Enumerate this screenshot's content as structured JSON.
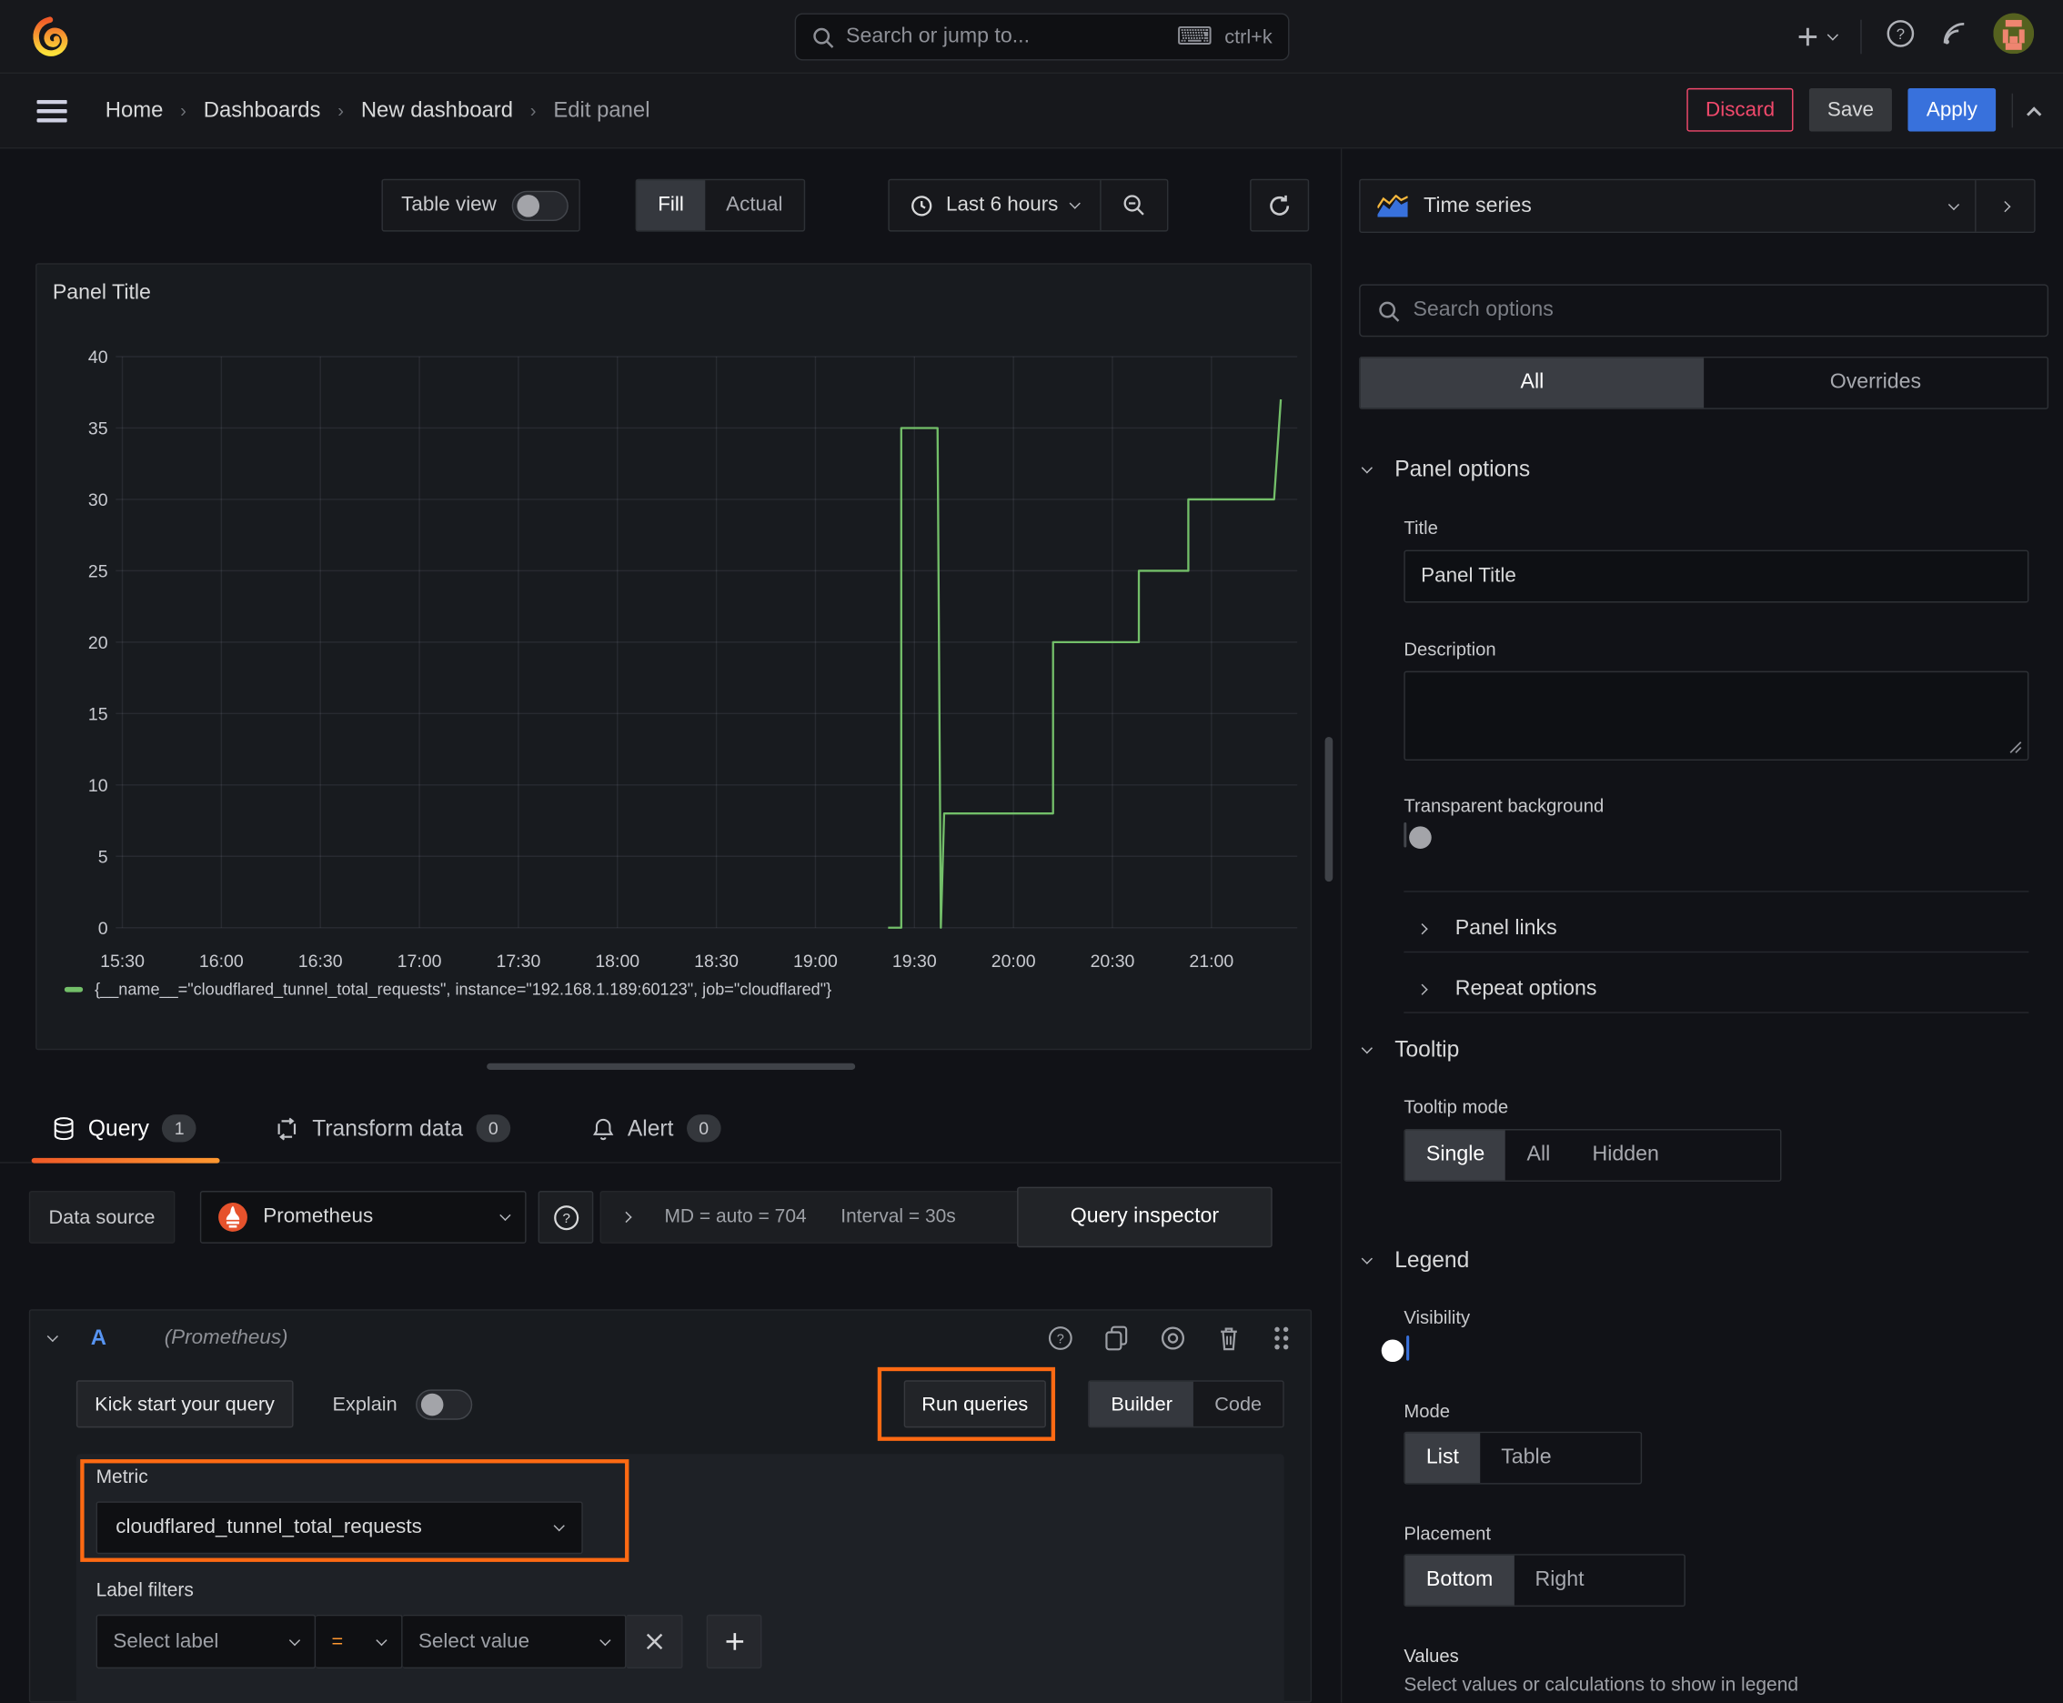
{
  "topnav": {
    "search_placeholder": "Search or jump to...",
    "search_shortcut": "ctrl+k"
  },
  "breadcrumb": {
    "items": [
      "Home",
      "Dashboards",
      "New dashboard",
      "Edit panel"
    ]
  },
  "actions": {
    "discard": "Discard",
    "save": "Save",
    "apply": "Apply"
  },
  "panel_toolbar": {
    "table_view": "Table view",
    "fill": "Fill",
    "actual": "Actual",
    "time_range": "Last 6 hours"
  },
  "panel": {
    "title": "Panel Title"
  },
  "chart_data": {
    "type": "line",
    "title": "Panel Title",
    "x_ticks": [
      "15:30",
      "16:00",
      "16:30",
      "17:00",
      "17:30",
      "18:00",
      "18:30",
      "19:00",
      "19:30",
      "20:00",
      "20:30",
      "21:00"
    ],
    "x_range": [
      "15:30",
      "21:26"
    ],
    "y_ticks": [
      0,
      5,
      10,
      15,
      20,
      25,
      30,
      35,
      40
    ],
    "ylim": [
      0,
      40
    ],
    "grid": true,
    "legend_position": "bottom",
    "series": [
      {
        "name": "{__name__=\"cloudflared_tunnel_total_requests\", instance=\"192.168.1.189:60123\", job=\"cloudflared\"}",
        "color": "#73bf69",
        "points": [
          [
            "19:22",
            0
          ],
          [
            "19:26",
            0
          ],
          [
            "19:26",
            35
          ],
          [
            "19:37",
            35
          ],
          [
            "19:38",
            0
          ],
          [
            "19:39",
            8
          ],
          [
            "20:12",
            8
          ],
          [
            "20:12",
            20
          ],
          [
            "20:38",
            20
          ],
          [
            "20:38",
            25
          ],
          [
            "20:53",
            25
          ],
          [
            "20:53",
            30
          ],
          [
            "21:19",
            30
          ],
          [
            "21:21",
            37
          ]
        ]
      }
    ]
  },
  "query_tabs": {
    "query": "Query",
    "query_count": "1",
    "transform": "Transform data",
    "transform_count": "0",
    "alert": "Alert",
    "alert_count": "0"
  },
  "datasource_row": {
    "label": "Data source",
    "value": "Prometheus",
    "stats": "MD = auto = 704",
    "interval": "Interval = 30s",
    "inspector": "Query inspector"
  },
  "query_editor": {
    "ref_id": "A",
    "ds_hint": "(Prometheus)",
    "kick_start": "Kick start your query",
    "explain": "Explain",
    "run_queries": "Run queries",
    "builder": "Builder",
    "code": "Code",
    "metric_label": "Metric",
    "metric_value": "cloudflared_tunnel_total_requests",
    "label_filters_label": "Label filters",
    "select_label": "Select label",
    "operator": "=",
    "select_value": "Select value",
    "remove": "x",
    "add": "+"
  },
  "sidebar": {
    "viz_type": "Time series",
    "search_placeholder": "Search options",
    "filter_tabs": {
      "all": "All",
      "overrides": "Overrides"
    },
    "panel_options": {
      "title": "Panel options",
      "title_label": "Title",
      "title_value": "Panel Title",
      "description_label": "Description",
      "transparent_label": "Transparent background",
      "panel_links": "Panel links",
      "repeat_options": "Repeat options"
    },
    "tooltip": {
      "title": "Tooltip",
      "mode_label": "Tooltip mode",
      "options": [
        "Single",
        "All",
        "Hidden"
      ],
      "selected": "Single"
    },
    "legend": {
      "title": "Legend",
      "visibility_label": "Visibility",
      "mode_label": "Mode",
      "mode_options": [
        "List",
        "Table"
      ],
      "mode_selected": "List",
      "placement_label": "Placement",
      "placement_options": [
        "Bottom",
        "Right"
      ],
      "placement_selected": "Bottom",
      "values_label": "Values",
      "values_help": "Select values or calculations to show in legend"
    }
  },
  "colors": {
    "accent_orange": "#ff780a",
    "series_green": "#73bf69",
    "primary_blue": "#3871dc",
    "discard_red": "#f2496c",
    "annotation_orange": "#ff6a13"
  }
}
